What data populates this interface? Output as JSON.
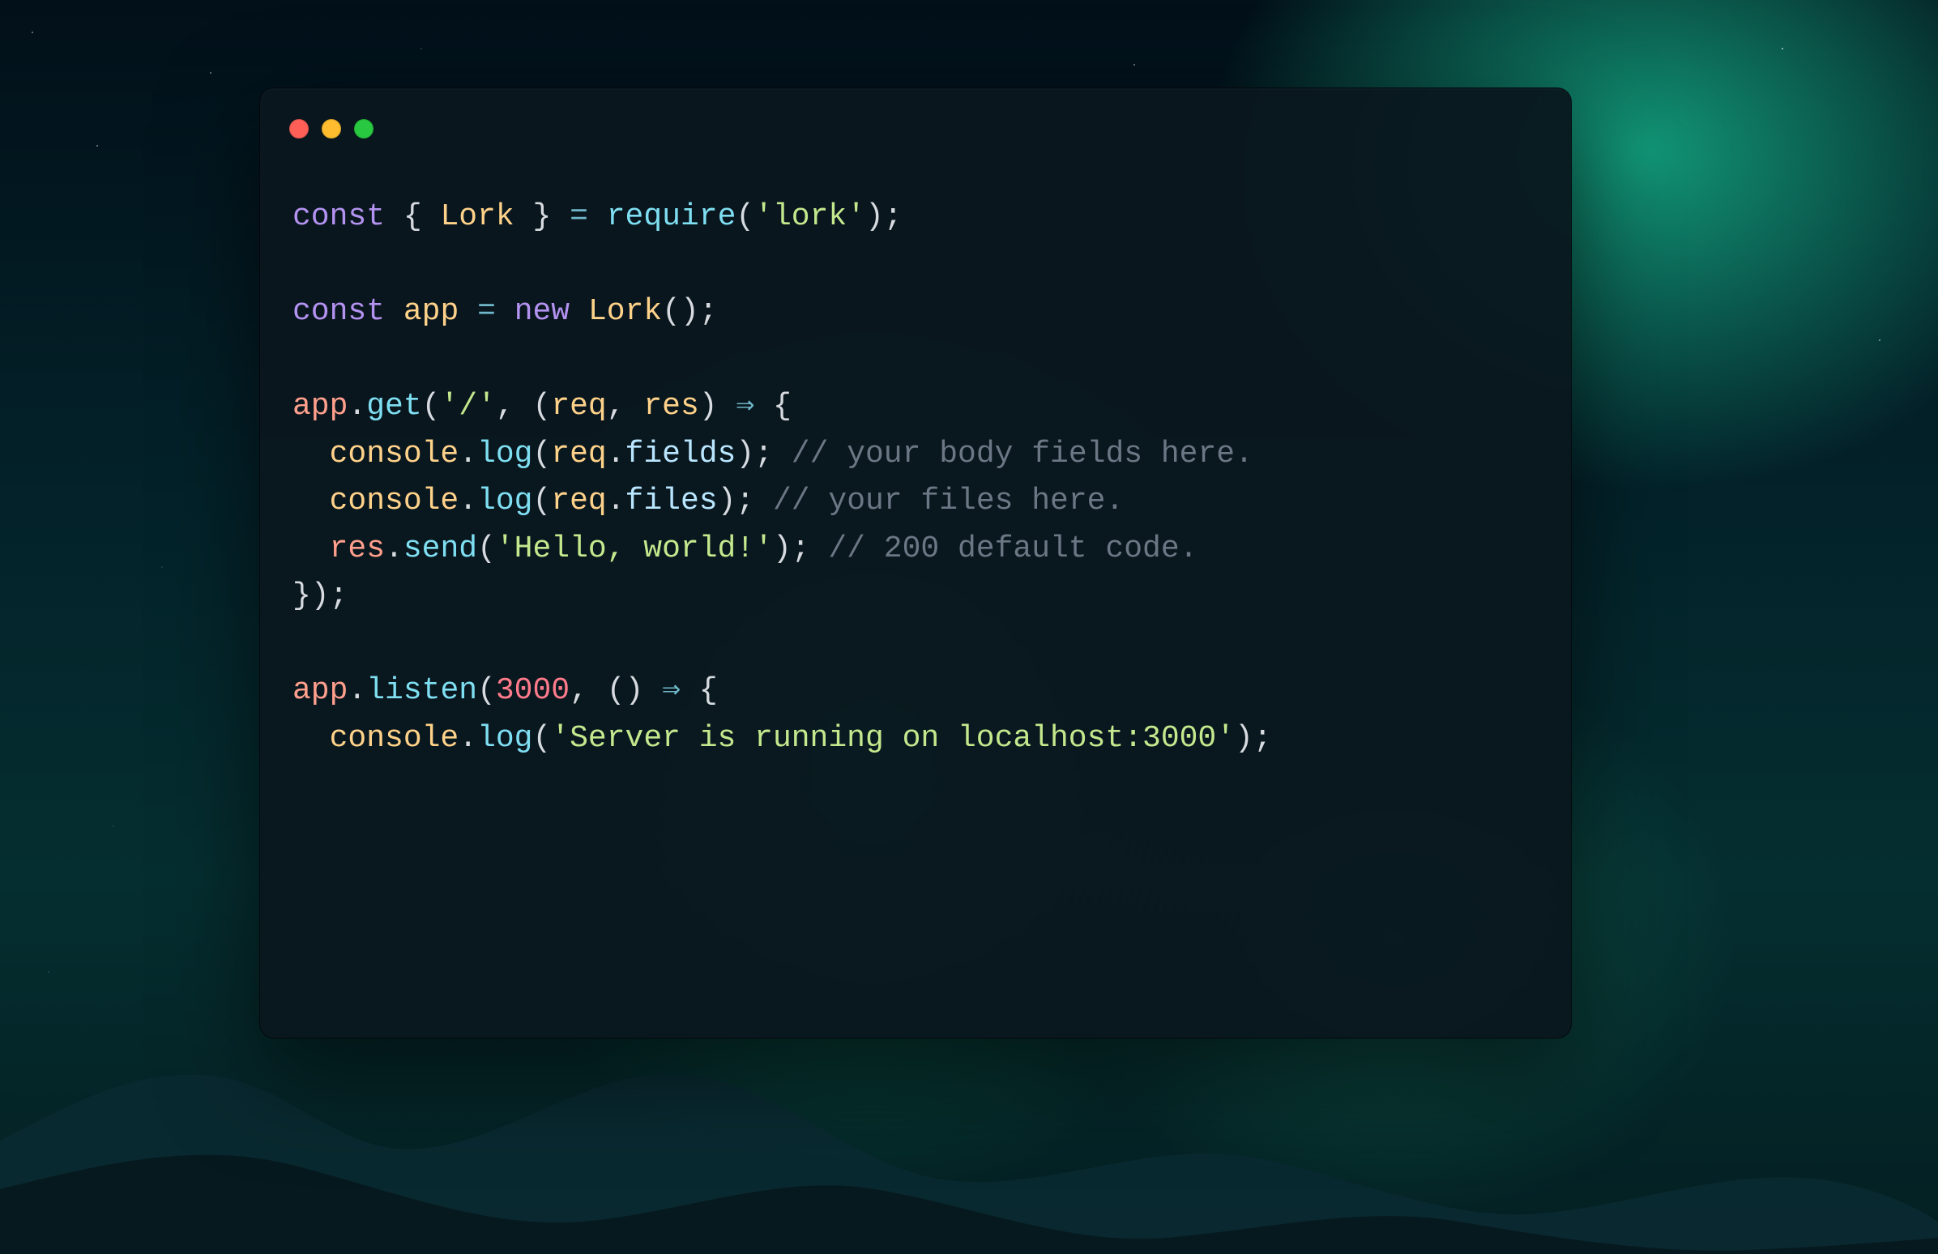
{
  "window": {
    "traffic_lights": {
      "red": "#ff5f57",
      "yellow": "#febc2e",
      "green": "#28c840"
    }
  },
  "code": {
    "line1": {
      "kw_const": "const",
      "brace_open": "{",
      "ident_Lork": "Lork",
      "brace_close": "}",
      "op_eq": "=",
      "fn_require": "require",
      "paren_open": "(",
      "str_lork": "'lork'",
      "paren_close_semi": ");"
    },
    "line3": {
      "kw_const": "const",
      "ident_app": "app",
      "op_eq": "=",
      "kw_new": "new",
      "ident_Lork": "Lork",
      "parens_semi": "();"
    },
    "line5": {
      "obj_app": "app",
      "dot": ".",
      "fn_get": "get",
      "paren_open": "(",
      "str_slash": "'/'",
      "comma": ",",
      "paren2_open": "(",
      "ident_req": "req",
      "comma2": ",",
      "ident_res": "res",
      "paren2_close": ")",
      "arrow": "⇒",
      "brace_open": "{"
    },
    "line6": {
      "indent": "  ",
      "ident_console": "console",
      "dot": ".",
      "fn_log": "log",
      "paren_open": "(",
      "ident_req": "req",
      "dot2": ".",
      "prop_fields": "fields",
      "paren_close_semi": ");",
      "comment": "// your body fields here."
    },
    "line7": {
      "indent": "  ",
      "ident_console": "console",
      "dot": ".",
      "fn_log": "log",
      "paren_open": "(",
      "ident_req": "req",
      "dot2": ".",
      "prop_files": "files",
      "paren_close_semi": ");",
      "comment": "// your files here."
    },
    "line8": {
      "indent": "  ",
      "obj_res": "res",
      "dot": ".",
      "fn_send": "send",
      "paren_open": "(",
      "str_hello": "'Hello, world!'",
      "paren_close_semi": ");",
      "comment": "// 200 default code."
    },
    "line9": {
      "close": "});"
    },
    "line11": {
      "obj_app": "app",
      "dot": ".",
      "fn_listen": "listen",
      "paren_open": "(",
      "num_3000": "3000",
      "comma": ",",
      "parens_unit": "()",
      "arrow": "⇒",
      "brace_open": "{"
    },
    "line12": {
      "indent": "  ",
      "ident_console": "console",
      "dot": ".",
      "fn_log": "log",
      "paren_open": "(",
      "str_running": "'Server is running on localhost:3000'",
      "paren_close_semi": ");"
    }
  }
}
